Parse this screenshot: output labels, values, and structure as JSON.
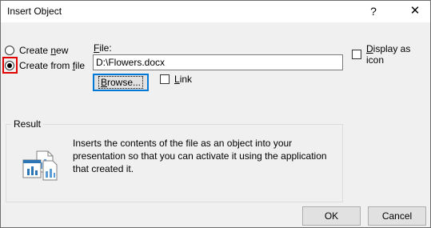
{
  "dialog": {
    "title": "Insert Object",
    "help_label": "?",
    "close_label": "✕"
  },
  "source": {
    "create_new_prefix": "Create ",
    "create_new_access": "n",
    "create_new_suffix": "ew",
    "create_from_file_prefix": "Create from ",
    "create_from_file_access": "f",
    "create_from_file_suffix": "ile",
    "selected": "create_from_file"
  },
  "file": {
    "label_access": "F",
    "label_suffix": "ile:",
    "value": "D:\\Flowers.docx",
    "browse_access": "B",
    "browse_suffix": "rowse...",
    "link_access": "L",
    "link_suffix": "ink",
    "link_checked": false
  },
  "display_as_icon": {
    "label_prefix": "",
    "label_access": "D",
    "label_suffix": "isplay as icon",
    "checked": false
  },
  "result": {
    "label": "Result",
    "text": "Inserts the contents of the file as an object into your presentation so that you can activate it using the application that created it.",
    "icon": "document-object-icon"
  },
  "footer": {
    "ok_label": "OK",
    "cancel_label": "Cancel"
  },
  "colors": {
    "highlight": "#e00000",
    "focus_border": "#0078d7"
  }
}
